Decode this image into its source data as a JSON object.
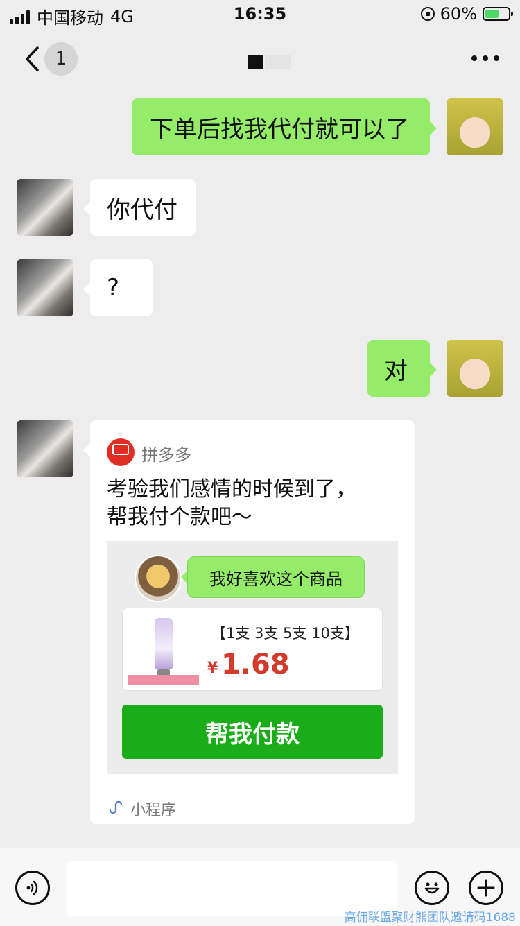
{
  "status_bar": {
    "carrier": "中国移动",
    "network": "4G",
    "time": "16:35",
    "battery_percent": "60%",
    "battery_level": 0.6
  },
  "nav": {
    "back_badge": "1"
  },
  "messages": [
    {
      "side": "right",
      "text": "下单后找我代付就可以了"
    },
    {
      "side": "left",
      "text": "你代付"
    },
    {
      "side": "left",
      "text": "?"
    },
    {
      "side": "right",
      "text": "对"
    }
  ],
  "card": {
    "source": "拼多多",
    "text_line1": "考验我们感情的时候到了，",
    "text_line2": "帮我付个款吧～",
    "inner_bubble": "我好喜欢这个商品",
    "product_title": "【1支 3支 5支 10支】",
    "currency": "¥",
    "price": "1.68",
    "pay_button": "帮我付款",
    "mini_program_label": "小程序"
  },
  "watermark": "高佣联盟聚财熊团队邀请码1688",
  "colors": {
    "green_bubble": "#95ec69",
    "pay_button": "#1aad19",
    "price": "#d33a2c",
    "pdd_red": "#e02e24"
  }
}
